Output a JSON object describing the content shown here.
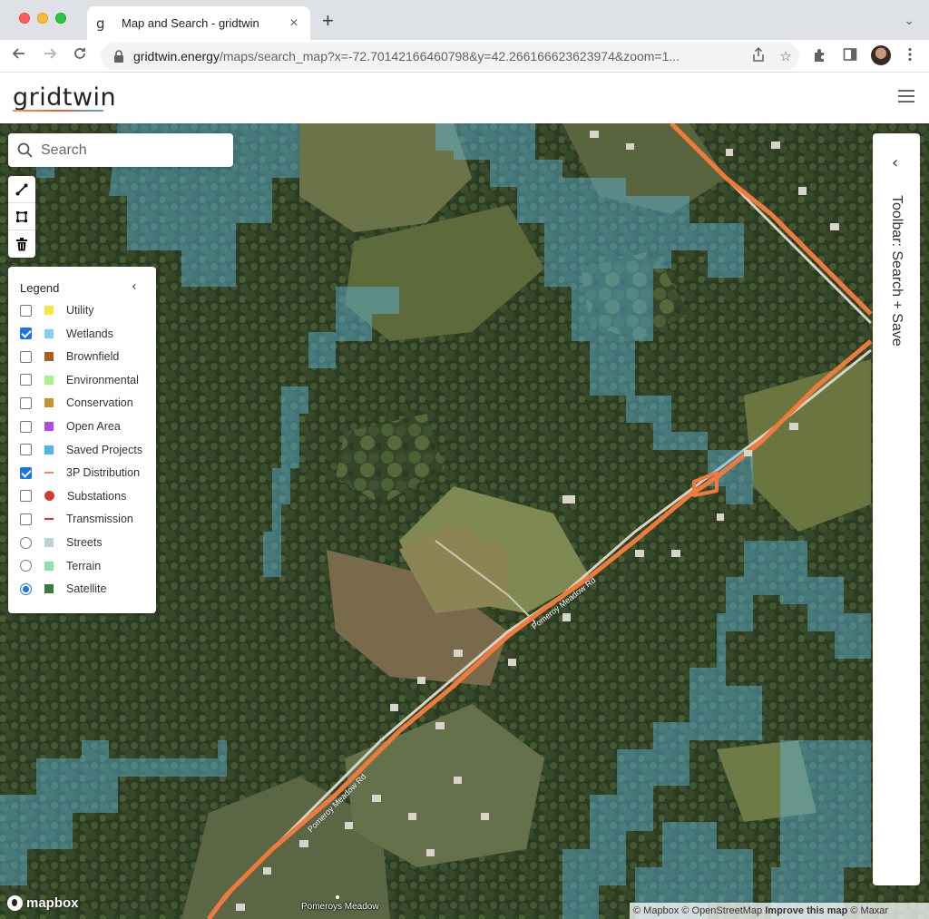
{
  "browser": {
    "tab_favicon": "g",
    "tab_title": "Map and Search - gridtwin",
    "tab_close": "×",
    "new_tab": "+",
    "tab_menu": "⌄",
    "url_host": "gridtwin.energy",
    "url_path": "/maps/search_map?x=-72.70142166460798&y=42.266166623623974&zoom=1...",
    "icons": [
      "back-icon",
      "forward-icon",
      "reload-icon",
      "lock-icon",
      "share-icon",
      "star-icon",
      "extensions-icon",
      "sidepanel-icon",
      "avatar",
      "menu-icon"
    ]
  },
  "app": {
    "logo": "gridtwin"
  },
  "search": {
    "placeholder": "Search"
  },
  "legend": {
    "title": "Legend",
    "collapse": "‹",
    "items": [
      {
        "label": "Utility",
        "control": "checkbox",
        "checked": false,
        "swatch": "square",
        "color": "#f5e642"
      },
      {
        "label": "Wetlands",
        "control": "checkbox",
        "checked": true,
        "swatch": "square",
        "color": "#7dd3f0"
      },
      {
        "label": "Brownfield",
        "control": "checkbox",
        "checked": false,
        "swatch": "square",
        "color": "#b05a1e"
      },
      {
        "label": "Environmental",
        "control": "checkbox",
        "checked": false,
        "swatch": "square",
        "color": "#a8f08a"
      },
      {
        "label": "Conservation",
        "control": "checkbox",
        "checked": false,
        "swatch": "square",
        "color": "#c8922e"
      },
      {
        "label": "Open Area",
        "control": "checkbox",
        "checked": false,
        "swatch": "square",
        "color": "#b04ae8"
      },
      {
        "label": "Saved Projects",
        "control": "checkbox",
        "checked": false,
        "swatch": "square",
        "color": "#4ab8f0"
      },
      {
        "label": "3P Distribution",
        "control": "checkbox",
        "checked": true,
        "swatch": "line",
        "color": "#f58a4a"
      },
      {
        "label": "Substations",
        "control": "checkbox",
        "checked": false,
        "swatch": "dot",
        "color": "#d63a2a"
      },
      {
        "label": "Transmission",
        "control": "checkbox",
        "checked": false,
        "swatch": "line",
        "color": "#e0302a"
      },
      {
        "label": "Streets",
        "control": "radio",
        "checked": false,
        "swatch": "square",
        "color": "#bcd4e0"
      },
      {
        "label": "Terrain",
        "control": "radio",
        "checked": false,
        "swatch": "square",
        "color": "#8ee0a8"
      },
      {
        "label": "Satellite",
        "control": "radio",
        "checked": true,
        "swatch": "square",
        "color": "#3a7a3a"
      }
    ]
  },
  "sidepanel": {
    "chevron": "‹",
    "label": "Toolbar: Search + Save"
  },
  "map": {
    "mapbox_logo": "mapbox",
    "place_label": "Pomeroys Meadow",
    "road_label_1": "Pomeroy Meadow Rd",
    "road_label_2": "Pomeroy Meadow Rd",
    "attribution_1": "© Mapbox © OpenStreetMap ",
    "attribution_improve": "Improve this map",
    "attribution_2": " © Maxar",
    "colors": {
      "wetland": "#5fb8e0",
      "distribution_line": "#f07a3c"
    }
  }
}
